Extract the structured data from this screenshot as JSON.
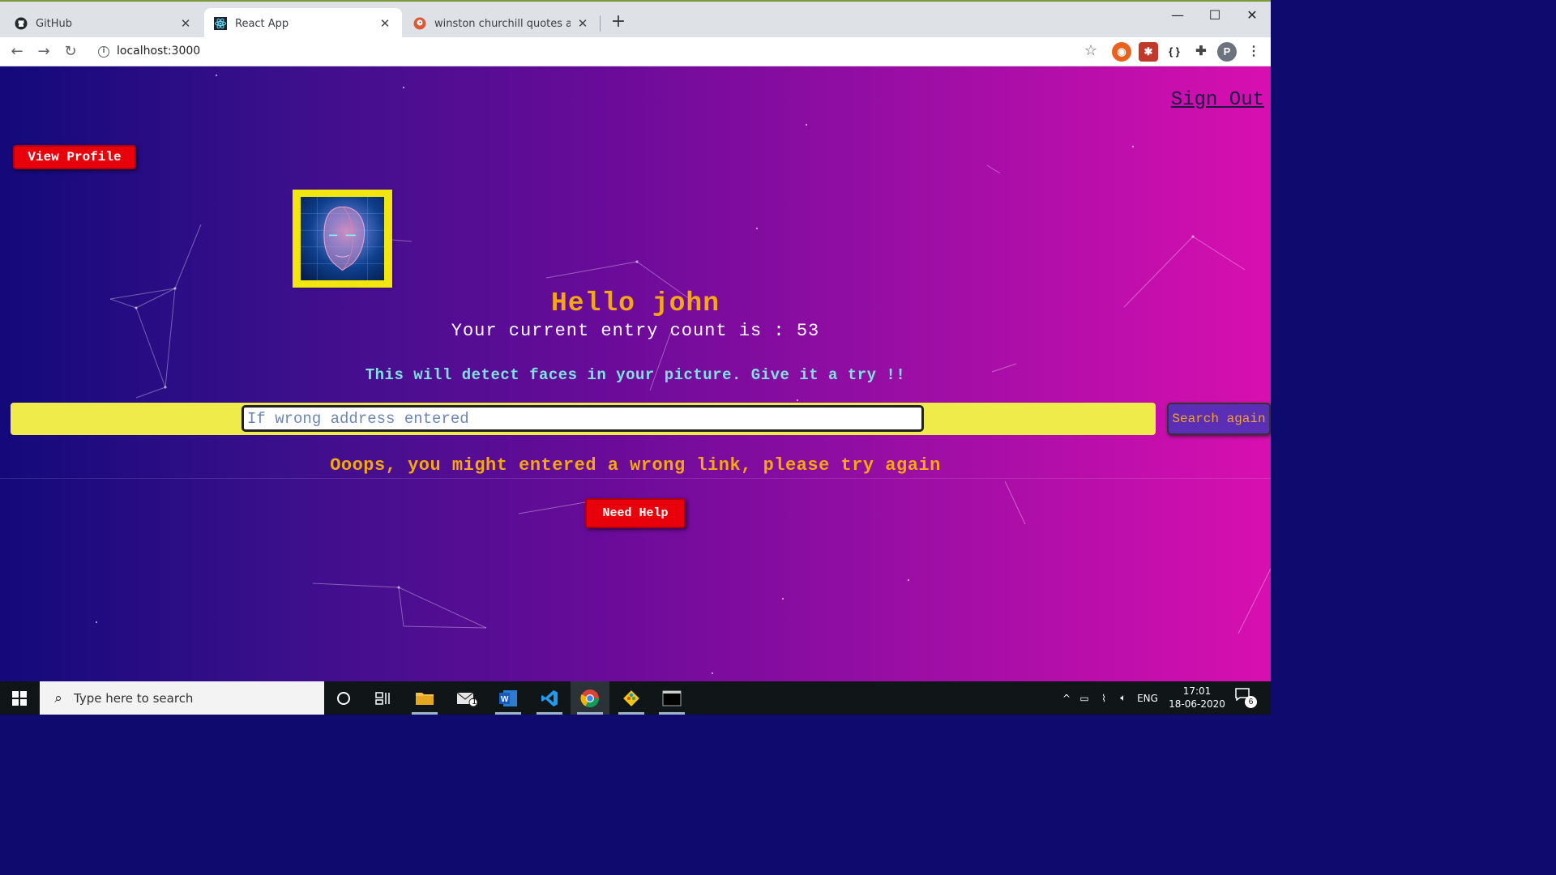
{
  "browser": {
    "tabs": [
      {
        "title": "GitHub",
        "icon": "github-icon"
      },
      {
        "title": "React App",
        "icon": "react-icon"
      },
      {
        "title": "winston churchill quotes at DuckDuckGo",
        "icon": "duckduckgo-icon"
      }
    ],
    "active_tab": 1,
    "url": "localhost:3000",
    "profile_initial": "P"
  },
  "page": {
    "sign_out": "Sign Out",
    "view_profile": "View Profile",
    "greeting": "Hello john",
    "entry_count_text": "Your current entry count is : 53",
    "detect_text": "This will detect faces in your picture. Give it a try !!",
    "search_placeholder": "If wrong address entered",
    "search_button": "Search again",
    "error_text": "Ooops, you might entered a wrong link, please try again",
    "help_button": "Need Help",
    "colors": {
      "accent_orange": "#f6a70d",
      "red_button": "#e8000b",
      "search_band": "#efeb4a",
      "gradient_start": "#13097a",
      "gradient_end": "#d80fb0"
    }
  },
  "taskbar": {
    "search_placeholder": "Type here to search",
    "language": "ENG",
    "time": "17:01",
    "date": "18-06-2020",
    "notification_count": "6",
    "mail_badge": "1"
  }
}
